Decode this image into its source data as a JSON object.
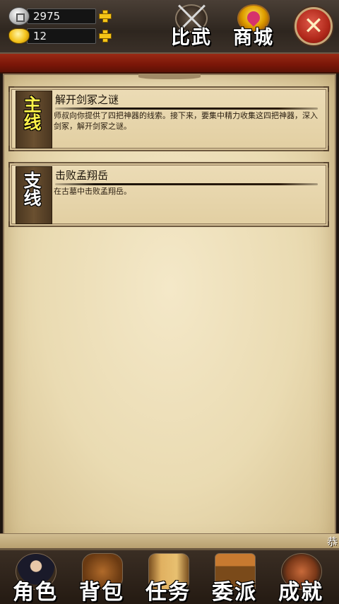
{
  "currency": {
    "silver": {
      "value": "2975",
      "icon": "silver-coin-icon"
    },
    "gold": {
      "value": "12",
      "icon": "gold-ingot-icon"
    }
  },
  "top_nav": {
    "duel_label": "比武",
    "shop_label": "商城",
    "close_icon": "close-icon",
    "close_glyph": "✕"
  },
  "quests": {
    "main": {
      "tag": "主线",
      "title": "解开剑冢之谜",
      "description": "师叔向你提供了四把神器的线索。接下来，要集中精力收集这四把神器，深入剑冢，解开剑冢之谜。"
    },
    "side": {
      "tag": "支线",
      "title": "击败孟翔岳",
      "description": "在古墓中击败孟翔岳。"
    }
  },
  "marquee": {
    "text": "恭"
  },
  "bottom_nav": {
    "items": [
      {
        "label": "角色",
        "icon": "character-portrait-icon"
      },
      {
        "label": "背包",
        "icon": "treasure-chest-icon"
      },
      {
        "label": "任务",
        "icon": "scroll-icon"
      },
      {
        "label": "委派",
        "icon": "pavilion-icon"
      },
      {
        "label": "成就",
        "icon": "achievement-emblem-icon"
      }
    ]
  },
  "colors": {
    "parchment": "#eadbb2",
    "red_band": "#7a1608",
    "main_tag_text": "#fff24a",
    "gold_plus": "#f5c518"
  }
}
